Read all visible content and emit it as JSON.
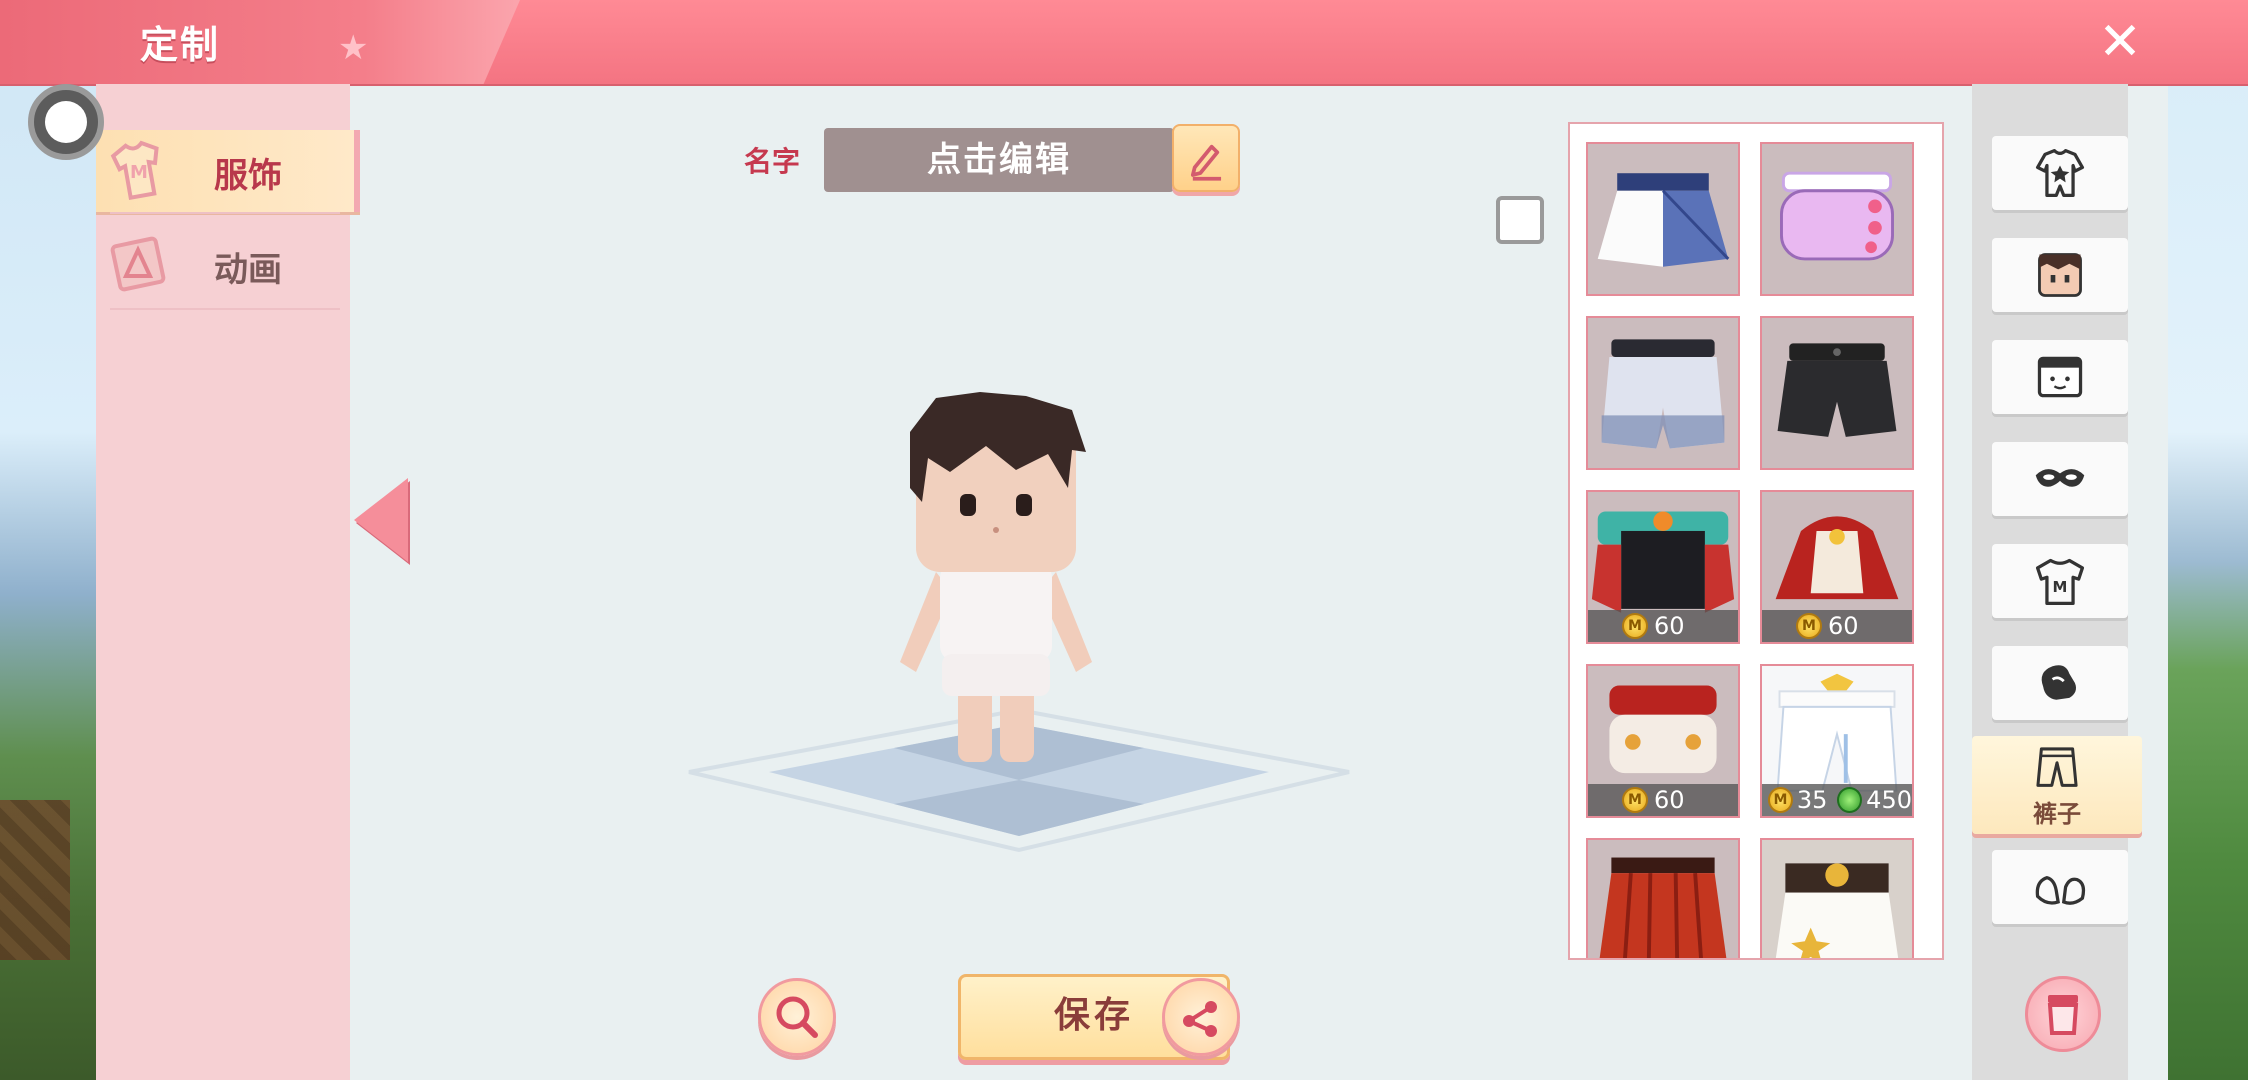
{
  "window": {
    "title": "定制"
  },
  "categories": [
    {
      "label": "服饰",
      "active": true
    },
    {
      "label": "动画",
      "active": false
    }
  ],
  "name": {
    "label": "名字",
    "value": "点击编辑"
  },
  "items": [
    {
      "name": "blue-white-skirt",
      "price": null
    },
    {
      "name": "pink-heart-shorts",
      "price": null
    },
    {
      "name": "white-floral-shorts",
      "price": null
    },
    {
      "name": "black-shorts",
      "price": null
    },
    {
      "name": "festive-teal-outfit",
      "price": "60"
    },
    {
      "name": "red-cape-outfit",
      "price": "60"
    },
    {
      "name": "red-tassel-shorts",
      "price": "60"
    },
    {
      "name": "white-gold-pants",
      "price": "35",
      "gem_price": "450"
    },
    {
      "name": "red-pleated-skirt",
      "price": null
    },
    {
      "name": "gold-star-skirt",
      "price": null
    }
  ],
  "right_categories": [
    {
      "name": "onesie"
    },
    {
      "name": "face"
    },
    {
      "name": "head"
    },
    {
      "name": "mask"
    },
    {
      "name": "shirt"
    },
    {
      "name": "gloves"
    },
    {
      "name": "pants",
      "label": "裤子",
      "active": true
    },
    {
      "name": "shoes"
    }
  ],
  "buttons": {
    "save": "保存"
  },
  "colors": {
    "title_bar": "#f47482",
    "accent": "#c6394f",
    "sidebar": "#f6d0d3"
  }
}
